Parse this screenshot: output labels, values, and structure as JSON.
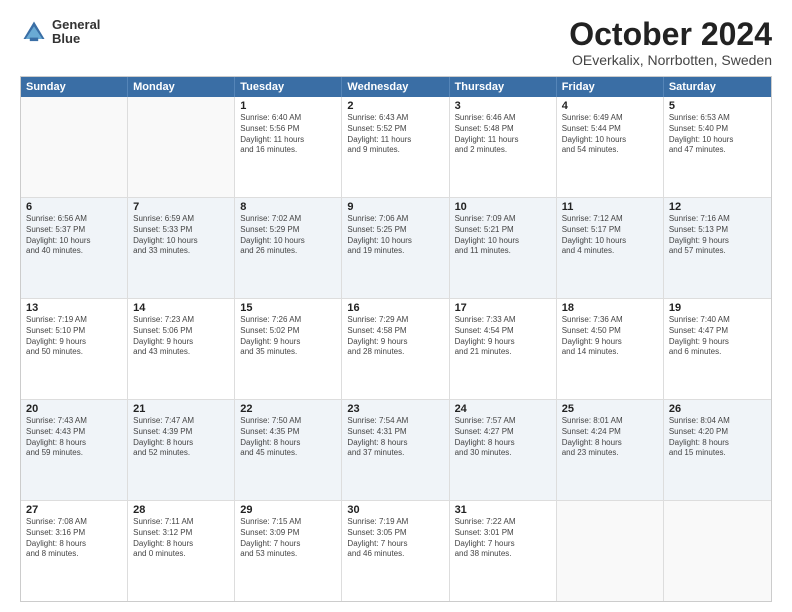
{
  "logo": {
    "line1": "General",
    "line2": "Blue"
  },
  "title": "October 2024",
  "subtitle": "OEverkalix, Norrbotten, Sweden",
  "header_days": [
    "Sunday",
    "Monday",
    "Tuesday",
    "Wednesday",
    "Thursday",
    "Friday",
    "Saturday"
  ],
  "rows": [
    [
      {
        "day": "",
        "text": ""
      },
      {
        "day": "",
        "text": ""
      },
      {
        "day": "1",
        "text": "Sunrise: 6:40 AM\nSunset: 5:56 PM\nDaylight: 11 hours\nand 16 minutes."
      },
      {
        "day": "2",
        "text": "Sunrise: 6:43 AM\nSunset: 5:52 PM\nDaylight: 11 hours\nand 9 minutes."
      },
      {
        "day": "3",
        "text": "Sunrise: 6:46 AM\nSunset: 5:48 PM\nDaylight: 11 hours\nand 2 minutes."
      },
      {
        "day": "4",
        "text": "Sunrise: 6:49 AM\nSunset: 5:44 PM\nDaylight: 10 hours\nand 54 minutes."
      },
      {
        "day": "5",
        "text": "Sunrise: 6:53 AM\nSunset: 5:40 PM\nDaylight: 10 hours\nand 47 minutes."
      }
    ],
    [
      {
        "day": "6",
        "text": "Sunrise: 6:56 AM\nSunset: 5:37 PM\nDaylight: 10 hours\nand 40 minutes."
      },
      {
        "day": "7",
        "text": "Sunrise: 6:59 AM\nSunset: 5:33 PM\nDaylight: 10 hours\nand 33 minutes."
      },
      {
        "day": "8",
        "text": "Sunrise: 7:02 AM\nSunset: 5:29 PM\nDaylight: 10 hours\nand 26 minutes."
      },
      {
        "day": "9",
        "text": "Sunrise: 7:06 AM\nSunset: 5:25 PM\nDaylight: 10 hours\nand 19 minutes."
      },
      {
        "day": "10",
        "text": "Sunrise: 7:09 AM\nSunset: 5:21 PM\nDaylight: 10 hours\nand 11 minutes."
      },
      {
        "day": "11",
        "text": "Sunrise: 7:12 AM\nSunset: 5:17 PM\nDaylight: 10 hours\nand 4 minutes."
      },
      {
        "day": "12",
        "text": "Sunrise: 7:16 AM\nSunset: 5:13 PM\nDaylight: 9 hours\nand 57 minutes."
      }
    ],
    [
      {
        "day": "13",
        "text": "Sunrise: 7:19 AM\nSunset: 5:10 PM\nDaylight: 9 hours\nand 50 minutes."
      },
      {
        "day": "14",
        "text": "Sunrise: 7:23 AM\nSunset: 5:06 PM\nDaylight: 9 hours\nand 43 minutes."
      },
      {
        "day": "15",
        "text": "Sunrise: 7:26 AM\nSunset: 5:02 PM\nDaylight: 9 hours\nand 35 minutes."
      },
      {
        "day": "16",
        "text": "Sunrise: 7:29 AM\nSunset: 4:58 PM\nDaylight: 9 hours\nand 28 minutes."
      },
      {
        "day": "17",
        "text": "Sunrise: 7:33 AM\nSunset: 4:54 PM\nDaylight: 9 hours\nand 21 minutes."
      },
      {
        "day": "18",
        "text": "Sunrise: 7:36 AM\nSunset: 4:50 PM\nDaylight: 9 hours\nand 14 minutes."
      },
      {
        "day": "19",
        "text": "Sunrise: 7:40 AM\nSunset: 4:47 PM\nDaylight: 9 hours\nand 6 minutes."
      }
    ],
    [
      {
        "day": "20",
        "text": "Sunrise: 7:43 AM\nSunset: 4:43 PM\nDaylight: 8 hours\nand 59 minutes."
      },
      {
        "day": "21",
        "text": "Sunrise: 7:47 AM\nSunset: 4:39 PM\nDaylight: 8 hours\nand 52 minutes."
      },
      {
        "day": "22",
        "text": "Sunrise: 7:50 AM\nSunset: 4:35 PM\nDaylight: 8 hours\nand 45 minutes."
      },
      {
        "day": "23",
        "text": "Sunrise: 7:54 AM\nSunset: 4:31 PM\nDaylight: 8 hours\nand 37 minutes."
      },
      {
        "day": "24",
        "text": "Sunrise: 7:57 AM\nSunset: 4:27 PM\nDaylight: 8 hours\nand 30 minutes."
      },
      {
        "day": "25",
        "text": "Sunrise: 8:01 AM\nSunset: 4:24 PM\nDaylight: 8 hours\nand 23 minutes."
      },
      {
        "day": "26",
        "text": "Sunrise: 8:04 AM\nSunset: 4:20 PM\nDaylight: 8 hours\nand 15 minutes."
      }
    ],
    [
      {
        "day": "27",
        "text": "Sunrise: 7:08 AM\nSunset: 3:16 PM\nDaylight: 8 hours\nand 8 minutes."
      },
      {
        "day": "28",
        "text": "Sunrise: 7:11 AM\nSunset: 3:12 PM\nDaylight: 8 hours\nand 0 minutes."
      },
      {
        "day": "29",
        "text": "Sunrise: 7:15 AM\nSunset: 3:09 PM\nDaylight: 7 hours\nand 53 minutes."
      },
      {
        "day": "30",
        "text": "Sunrise: 7:19 AM\nSunset: 3:05 PM\nDaylight: 7 hours\nand 46 minutes."
      },
      {
        "day": "31",
        "text": "Sunrise: 7:22 AM\nSunset: 3:01 PM\nDaylight: 7 hours\nand 38 minutes."
      },
      {
        "day": "",
        "text": ""
      },
      {
        "day": "",
        "text": ""
      }
    ]
  ]
}
